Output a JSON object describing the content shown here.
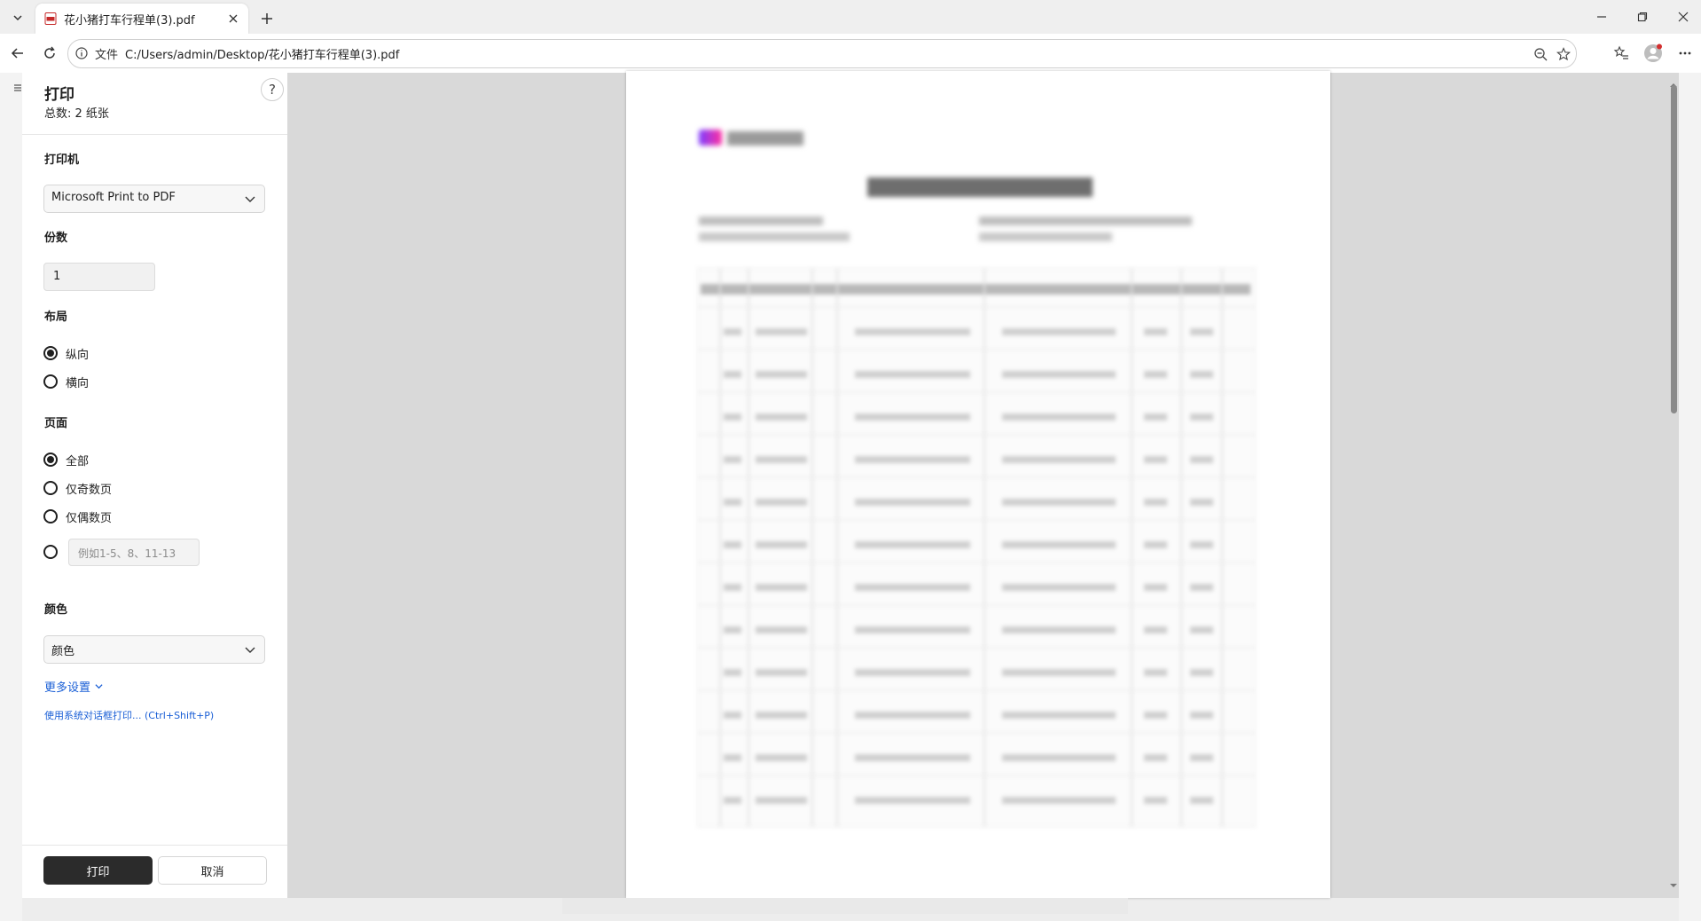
{
  "tab": {
    "title": "花小猪打车行程单(3).pdf"
  },
  "address": {
    "scheme_label": "文件",
    "url": "C:/Users/admin/Desktop/花小猪打车行程单(3).pdf"
  },
  "print": {
    "title": "打印",
    "total": "总数: 2 纸张",
    "printer_label": "打印机",
    "printer_value": "Microsoft Print to PDF",
    "copies_label": "份数",
    "copies_value": "1",
    "layout_label": "布局",
    "layout_options": [
      "纵向",
      "横向"
    ],
    "pages_label": "页面",
    "pages_options": [
      "全部",
      "仅奇数页",
      "仅偶数页"
    ],
    "range_placeholder": "例如1-5、8、11-13",
    "color_label": "颜色",
    "color_value": "颜色",
    "more_settings": "更多设置",
    "system_dialog": "使用系统对话框打印... (Ctrl+Shift+P)",
    "print_button": "打印",
    "cancel_button": "取消"
  },
  "colors": {
    "accent_link": "#1a5fd6",
    "primary_button": "#2b2b2b"
  }
}
